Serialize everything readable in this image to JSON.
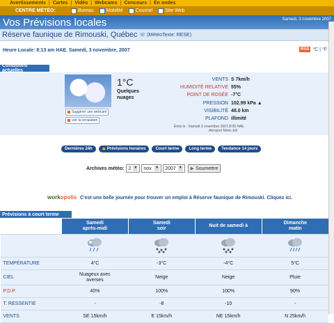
{
  "topnav": [
    "Avertissements",
    "Cartes",
    "Vidéo",
    "Webcams",
    "Concours",
    "En ondes"
  ],
  "subnav": {
    "label": "CENTRE MÉTÉO:",
    "items": [
      "Bureau",
      "Mobilité",
      "Courriel",
      "Site Web"
    ]
  },
  "banner": {
    "title": "Vos Prévisions locales",
    "date": "Samedi, 3 novembre 2007"
  },
  "location": {
    "name": "Réserve faunique de Rimouski, Québec",
    "code": "(MétéoTexte: RESE)"
  },
  "local_time": "Heure Locale: 8:13 am HAE. Samedi, 3 novembre, 2007",
  "units": {
    "rss": "RSS",
    "toggle": "°C | °F"
  },
  "current": {
    "header": "Conditions actuelles",
    "temp": "1°C",
    "condition_line1": "Quelques",
    "condition_line2": "nuages",
    "webcam_btn": "Suggérer une webcam",
    "traffic_btn": "voir la circulation",
    "obs": [
      {
        "label": "VENTS",
        "value": "S 7km/h",
        "color": "blue"
      },
      {
        "label": "HUMIDITÉ RELATIVE",
        "value": "55%",
        "color": "red"
      },
      {
        "label": "POINT DE ROSÉE",
        "value": "-7°C",
        "color": "red"
      },
      {
        "label": "PRESSION",
        "value": "102.99 kPa ▲",
        "color": "blue"
      },
      {
        "label": "VISIBILITÉ",
        "value": "48.0 km",
        "color": "blue"
      },
      {
        "label": "PLAFOND",
        "value": "illimité",
        "color": "blue"
      }
    ],
    "issued": "Émis le : Samedi 3 novembre 2007,8:00 HAE.",
    "station": "Aéroport Mont-Joli"
  },
  "tabs": [
    "Dernières 24h",
    "Prévisions horaires",
    "Court terme",
    "Long terme",
    "Tendance 14 jours"
  ],
  "archive": {
    "label": "Archives météo:",
    "day": "2",
    "month": "nov.",
    "year": "2007",
    "submit": "Soumettre"
  },
  "job": {
    "logo_a": "work",
    "logo_b": "opolis",
    "message": "C'est une belle journée pour trouver un emploi à Réserve faunique de Rimouski. Cliquez ici."
  },
  "forecast": {
    "header": "Prévisions à court terme",
    "periods": [
      {
        "line1": "Samedi",
        "line2": "après-midi",
        "temp": "4°C",
        "sky": [
          "Nuageux avec",
          "averses"
        ],
        "pop": "40%",
        "feels": "-",
        "wind": "SE 15km/h"
      },
      {
        "line1": "Samedi",
        "line2": "soir",
        "temp": "-3°C",
        "sky": [
          "Neige"
        ],
        "pop": "100%",
        "feels": "-8",
        "wind": "E 15km/h"
      },
      {
        "line1": "Nuit de samedi à",
        "line2": "",
        "temp": "-4°C",
        "sky": [
          "Neige"
        ],
        "pop": "100%",
        "feels": "-10",
        "wind": "NE 15km/h"
      },
      {
        "line1": "Dimanche",
        "line2": "matin",
        "temp": "5°C",
        "sky": [
          "Pluie"
        ],
        "pop": "90%",
        "feels": "-",
        "wind": "N 25km/h"
      }
    ],
    "rows": {
      "temp": "TEMPÉRATURE",
      "sky": "CIEL",
      "pop": "P.D.P.",
      "feels": "T. RESSENTIE",
      "wind": "VENTS"
    }
  }
}
